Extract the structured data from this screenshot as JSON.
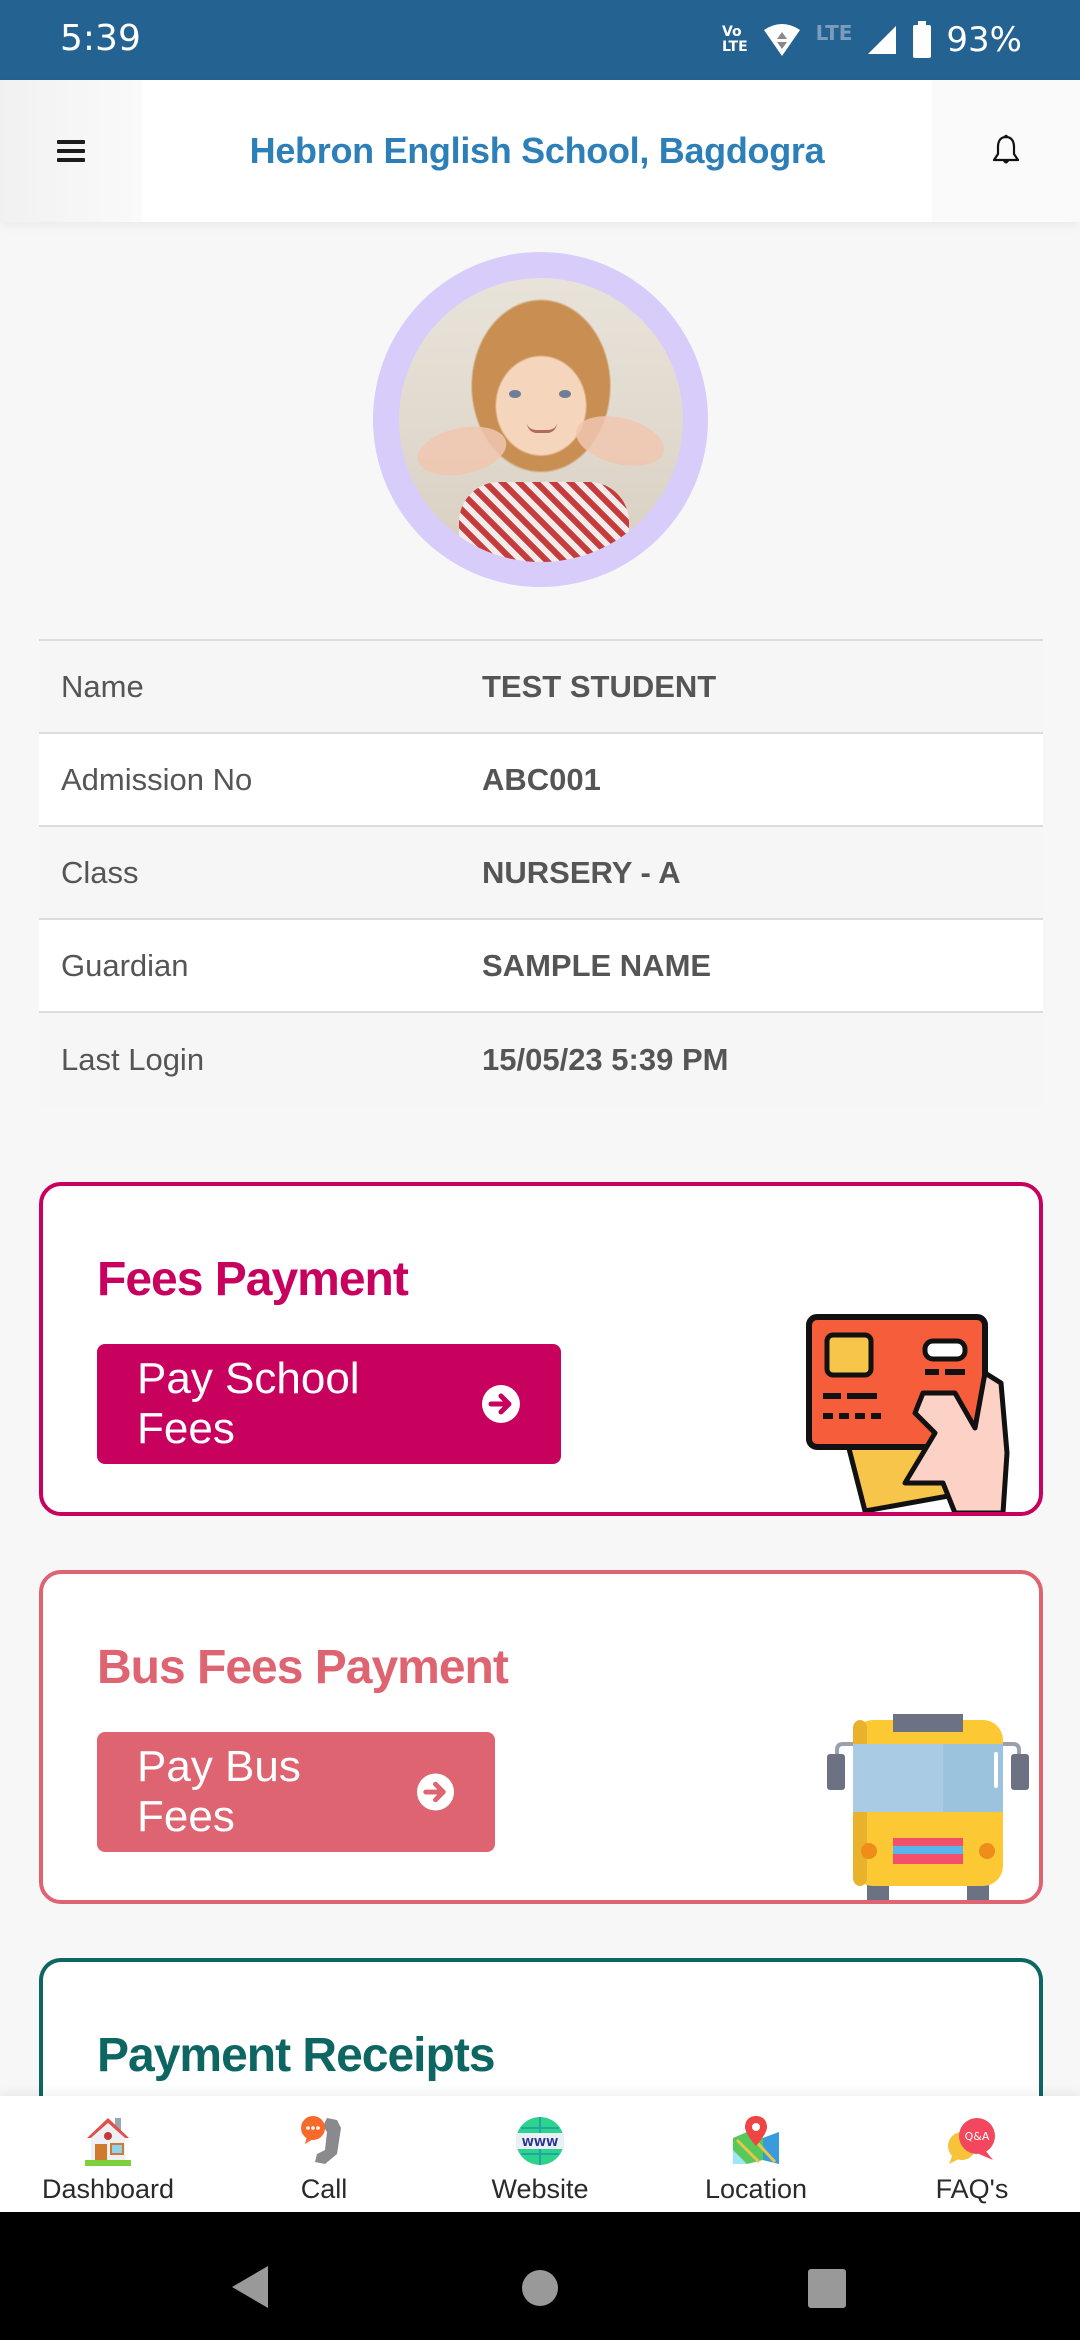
{
  "status_bar": {
    "time": "5:39",
    "volte_line1": "Vo",
    "volte_line2": "LTE",
    "network": "LTE",
    "battery": "93%"
  },
  "header": {
    "title": "Hebron English School, Bagdogra",
    "menu_icon": "hamburger-icon",
    "notification_icon": "bell-icon"
  },
  "profile": {
    "avatar_alt": "Student photo",
    "ring_color": "#d8ccfb"
  },
  "info_table": {
    "rows": [
      {
        "label": "Name",
        "value": "TEST STUDENT"
      },
      {
        "label": "Admission No",
        "value": "ABC001"
      },
      {
        "label": "Class",
        "value": "NURSERY - A"
      },
      {
        "label": "Guardian",
        "value": "SAMPLE NAME"
      },
      {
        "label": "Last Login",
        "value": "15/05/23 5:39 PM"
      }
    ]
  },
  "cards": {
    "fees": {
      "title": "Fees Payment",
      "button_label": "Pay School Fees",
      "color": "#c8005e",
      "illustration": "credit-card-hand-icon"
    },
    "bus": {
      "title": "Bus Fees Payment",
      "button_label": "Pay Bus Fees",
      "color": "#dd6470",
      "illustration": "school-bus-icon"
    },
    "receipts": {
      "title": "Payment Receipts",
      "color": "#0e6663"
    }
  },
  "bottom_nav": {
    "items": [
      {
        "label": "Dashboard",
        "icon": "house-icon"
      },
      {
        "label": "Call",
        "icon": "phone-chat-icon"
      },
      {
        "label": "Website",
        "icon": "globe-www-icon"
      },
      {
        "label": "Location",
        "icon": "map-pin-icon"
      },
      {
        "label": "FAQ's",
        "icon": "qa-bubble-icon"
      }
    ],
    "faq_badge": "Q&A",
    "www_badge": "WWW"
  },
  "theme": {
    "status_bar": "#246292",
    "header_title": "#2d7fb8"
  }
}
